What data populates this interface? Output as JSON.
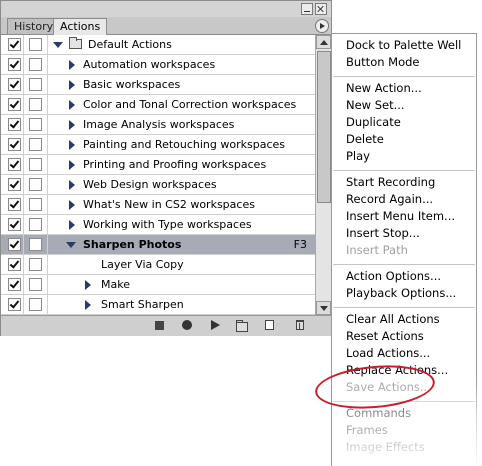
{
  "panel": {
    "tabs": [
      "History",
      "Actions"
    ],
    "active_tab": "Actions"
  },
  "rows": [
    {
      "label": "Default Actions",
      "kind": "set",
      "expanded": true,
      "checked": true
    },
    {
      "label": "Automation workspaces",
      "kind": "action",
      "checked": true
    },
    {
      "label": "Basic workspaces",
      "kind": "action",
      "checked": true
    },
    {
      "label": "Color and Tonal Correction workspaces",
      "kind": "action",
      "checked": true
    },
    {
      "label": "Image Analysis workspaces",
      "kind": "action",
      "checked": true
    },
    {
      "label": "Painting and Retouching workspaces",
      "kind": "action",
      "checked": true
    },
    {
      "label": "Printing and Proofing workspaces",
      "kind": "action",
      "checked": true
    },
    {
      "label": "Web Design workspaces",
      "kind": "action",
      "checked": true
    },
    {
      "label": "What's New in CS2 workspaces",
      "kind": "action",
      "checked": true
    },
    {
      "label": "Working with Type workspaces",
      "kind": "action",
      "checked": true
    },
    {
      "label": "Sharpen Photos",
      "kind": "action-open",
      "selected": true,
      "fkey": "F3",
      "checked": true
    },
    {
      "label": "Layer Via Copy",
      "kind": "step",
      "checked": true
    },
    {
      "label": "Make",
      "kind": "step-collapsed",
      "checked": true
    },
    {
      "label": "Smart Sharpen",
      "kind": "step-collapsed",
      "checked": true
    }
  ],
  "menu": {
    "groups": [
      [
        "Dock to Palette Well",
        "Button Mode"
      ],
      [
        "New Action...",
        "New Set...",
        "Duplicate",
        "Delete",
        "Play"
      ],
      [
        "Start Recording",
        "Record Again...",
        "Insert Menu Item...",
        "Insert Stop...",
        "Insert Path"
      ],
      [
        "Action Options...",
        "Playback Options..."
      ],
      [
        "Clear All Actions",
        "Reset Actions",
        "Load Actions...",
        "Replace Actions...",
        "Save Actions..."
      ],
      [
        "Commands",
        "Frames",
        "Image Effects"
      ]
    ],
    "disabled": [
      "Insert Path",
      "Save Actions..."
    ],
    "highlighted": "Save Actions..."
  },
  "colors": {
    "selected_row": "#a6abb6",
    "highlight_circle": "#c81e2b"
  }
}
